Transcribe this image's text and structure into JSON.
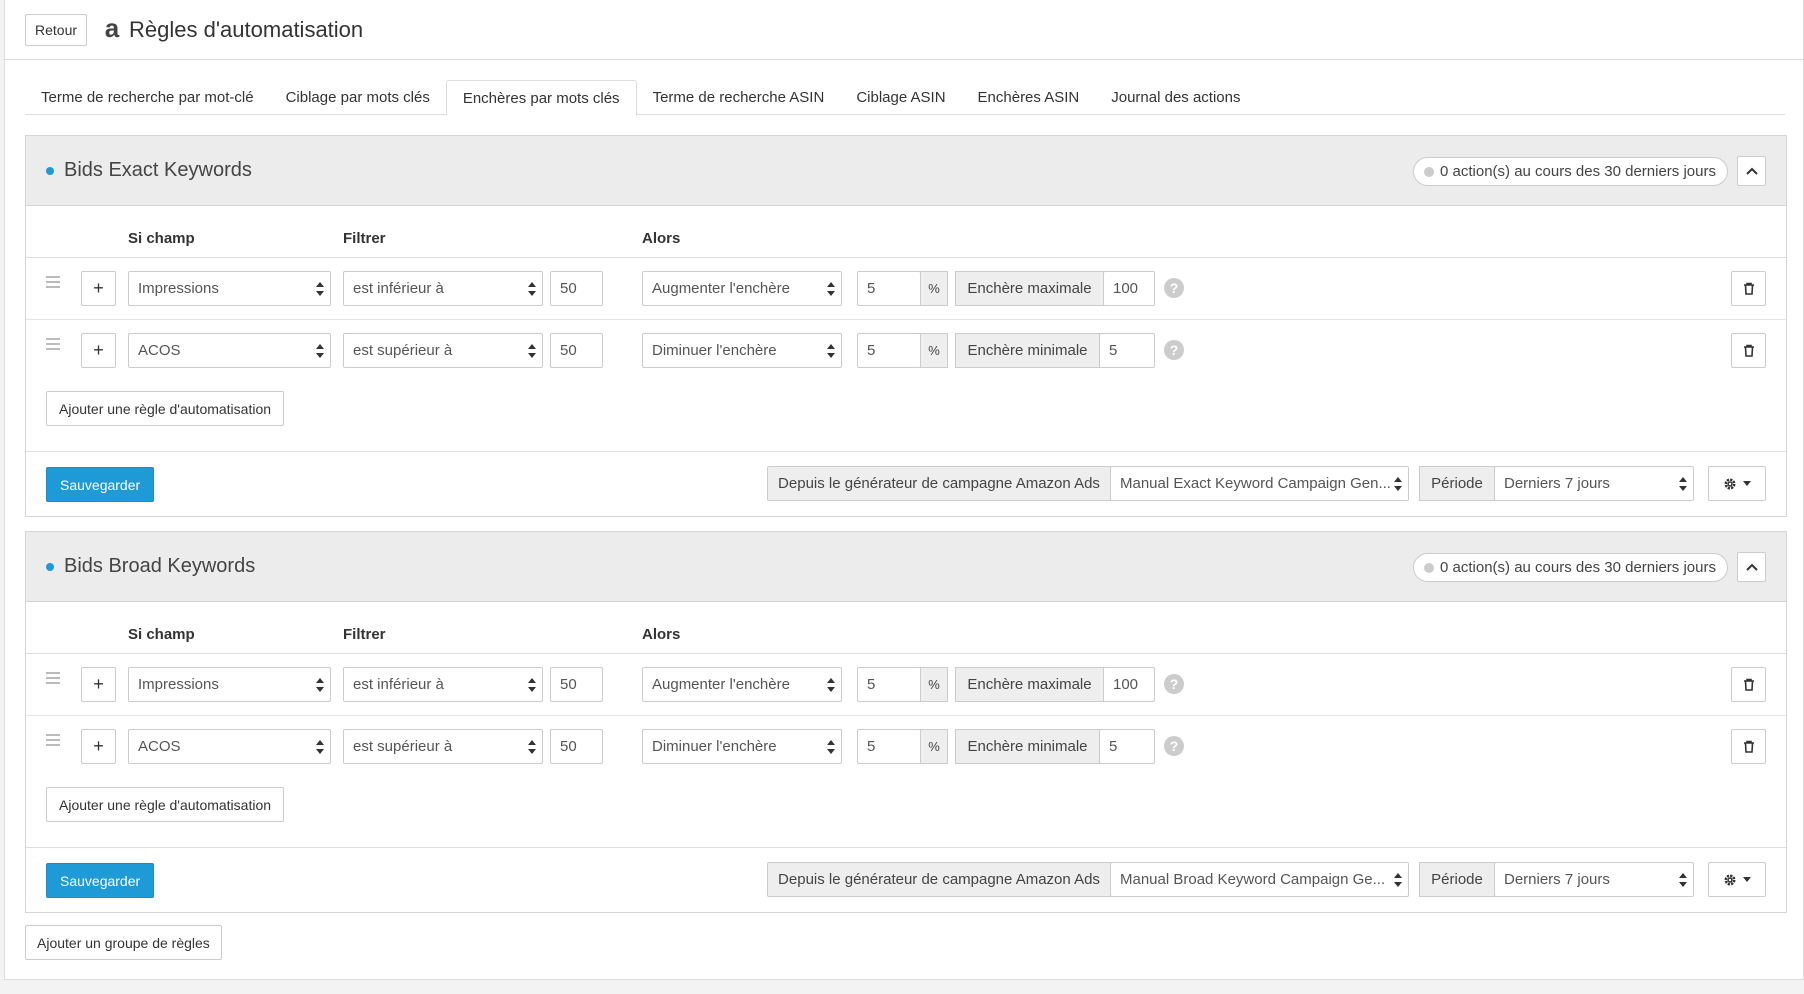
{
  "header": {
    "back_label": "Retour",
    "brand_icon": "amazon-icon",
    "title": "Règles d'automatisation"
  },
  "tabs": [
    {
      "label": "Terme de recherche par mot-clé",
      "active": false
    },
    {
      "label": "Ciblage par mots clés",
      "active": false
    },
    {
      "label": "Enchères par mots clés",
      "active": true
    },
    {
      "label": "Terme de recherche ASIN",
      "active": false
    },
    {
      "label": "Ciblage ASIN",
      "active": false
    },
    {
      "label": "Enchères ASIN",
      "active": false
    },
    {
      "label": "Journal des actions",
      "active": false
    }
  ],
  "columns": {
    "field": "Si champ",
    "filter": "Filtrer",
    "then": "Alors"
  },
  "groups": [
    {
      "title": "Bids Exact Keywords",
      "actions_badge": "0 action(s) au cours des 30 derniers jours",
      "rules": [
        {
          "field": "Impressions",
          "filter": "est inférieur à",
          "value": "50",
          "action": "Augmenter l'enchère",
          "amount": "5",
          "unit": "%",
          "limit_label": "Enchère maximale",
          "limit_value": "100"
        },
        {
          "field": "ACOS",
          "filter": "est supérieur à",
          "value": "50",
          "action": "Diminuer l'enchère",
          "amount": "5",
          "unit": "%",
          "limit_label": "Enchère minimale",
          "limit_value": "5"
        }
      ],
      "add_rule_label": "Ajouter une règle d'automatisation",
      "save_label": "Sauvegarder",
      "source_label": "Depuis le générateur de campagne Amazon Ads",
      "campaign": "Manual Exact Keyword Campaign Gen...",
      "period_label": "Période",
      "period": "Derniers 7 jours"
    },
    {
      "title": "Bids Broad Keywords",
      "actions_badge": "0 action(s) au cours des 30 derniers jours",
      "rules": [
        {
          "field": "Impressions",
          "filter": "est inférieur à",
          "value": "50",
          "action": "Augmenter l'enchère",
          "amount": "5",
          "unit": "%",
          "limit_label": "Enchère maximale",
          "limit_value": "100"
        },
        {
          "field": "ACOS",
          "filter": "est supérieur à",
          "value": "50",
          "action": "Diminuer l'enchère",
          "amount": "5",
          "unit": "%",
          "limit_label": "Enchère minimale",
          "limit_value": "5"
        }
      ],
      "add_rule_label": "Ajouter une règle d'automatisation",
      "save_label": "Sauvegarder",
      "source_label": "Depuis le générateur de campagne Amazon Ads",
      "campaign": "Manual Broad Keyword Campaign Ge...",
      "period_label": "Période",
      "period": "Derniers 7 jours"
    }
  ],
  "add_group_label": "Ajouter un groupe de règles"
}
